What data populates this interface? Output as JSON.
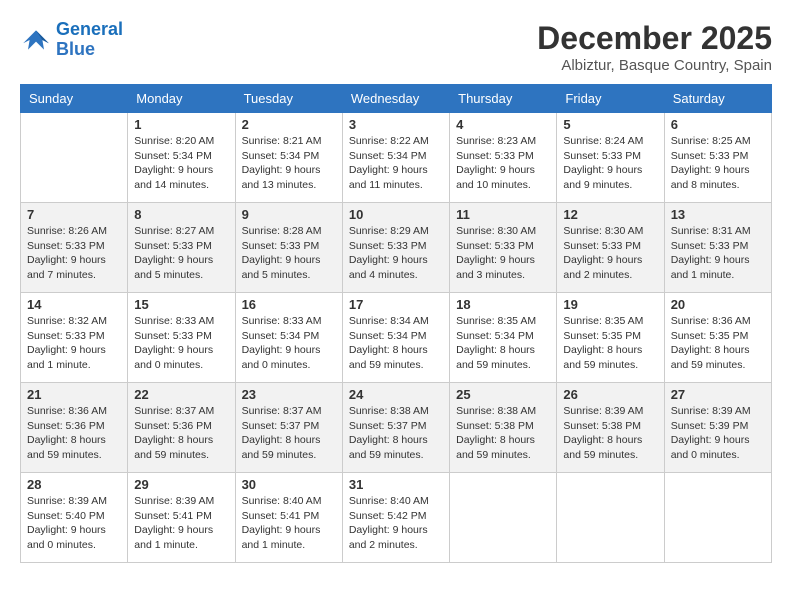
{
  "logo": {
    "line1": "General",
    "line2": "Blue"
  },
  "title": "December 2025",
  "location": "Albiztur, Basque Country, Spain",
  "days_of_week": [
    "Sunday",
    "Monday",
    "Tuesday",
    "Wednesday",
    "Thursday",
    "Friday",
    "Saturday"
  ],
  "weeks": [
    [
      {
        "day": "",
        "info": ""
      },
      {
        "day": "1",
        "info": "Sunrise: 8:20 AM\nSunset: 5:34 PM\nDaylight: 9 hours\nand 14 minutes."
      },
      {
        "day": "2",
        "info": "Sunrise: 8:21 AM\nSunset: 5:34 PM\nDaylight: 9 hours\nand 13 minutes."
      },
      {
        "day": "3",
        "info": "Sunrise: 8:22 AM\nSunset: 5:34 PM\nDaylight: 9 hours\nand 11 minutes."
      },
      {
        "day": "4",
        "info": "Sunrise: 8:23 AM\nSunset: 5:33 PM\nDaylight: 9 hours\nand 10 minutes."
      },
      {
        "day": "5",
        "info": "Sunrise: 8:24 AM\nSunset: 5:33 PM\nDaylight: 9 hours\nand 9 minutes."
      },
      {
        "day": "6",
        "info": "Sunrise: 8:25 AM\nSunset: 5:33 PM\nDaylight: 9 hours\nand 8 minutes."
      }
    ],
    [
      {
        "day": "7",
        "info": "Sunrise: 8:26 AM\nSunset: 5:33 PM\nDaylight: 9 hours\nand 7 minutes."
      },
      {
        "day": "8",
        "info": "Sunrise: 8:27 AM\nSunset: 5:33 PM\nDaylight: 9 hours\nand 5 minutes."
      },
      {
        "day": "9",
        "info": "Sunrise: 8:28 AM\nSunset: 5:33 PM\nDaylight: 9 hours\nand 5 minutes."
      },
      {
        "day": "10",
        "info": "Sunrise: 8:29 AM\nSunset: 5:33 PM\nDaylight: 9 hours\nand 4 minutes."
      },
      {
        "day": "11",
        "info": "Sunrise: 8:30 AM\nSunset: 5:33 PM\nDaylight: 9 hours\nand 3 minutes."
      },
      {
        "day": "12",
        "info": "Sunrise: 8:30 AM\nSunset: 5:33 PM\nDaylight: 9 hours\nand 2 minutes."
      },
      {
        "day": "13",
        "info": "Sunrise: 8:31 AM\nSunset: 5:33 PM\nDaylight: 9 hours\nand 1 minute."
      }
    ],
    [
      {
        "day": "14",
        "info": "Sunrise: 8:32 AM\nSunset: 5:33 PM\nDaylight: 9 hours\nand 1 minute."
      },
      {
        "day": "15",
        "info": "Sunrise: 8:33 AM\nSunset: 5:33 PM\nDaylight: 9 hours\nand 0 minutes."
      },
      {
        "day": "16",
        "info": "Sunrise: 8:33 AM\nSunset: 5:34 PM\nDaylight: 9 hours\nand 0 minutes."
      },
      {
        "day": "17",
        "info": "Sunrise: 8:34 AM\nSunset: 5:34 PM\nDaylight: 8 hours\nand 59 minutes."
      },
      {
        "day": "18",
        "info": "Sunrise: 8:35 AM\nSunset: 5:34 PM\nDaylight: 8 hours\nand 59 minutes."
      },
      {
        "day": "19",
        "info": "Sunrise: 8:35 AM\nSunset: 5:35 PM\nDaylight: 8 hours\nand 59 minutes."
      },
      {
        "day": "20",
        "info": "Sunrise: 8:36 AM\nSunset: 5:35 PM\nDaylight: 8 hours\nand 59 minutes."
      }
    ],
    [
      {
        "day": "21",
        "info": "Sunrise: 8:36 AM\nSunset: 5:36 PM\nDaylight: 8 hours\nand 59 minutes."
      },
      {
        "day": "22",
        "info": "Sunrise: 8:37 AM\nSunset: 5:36 PM\nDaylight: 8 hours\nand 59 minutes."
      },
      {
        "day": "23",
        "info": "Sunrise: 8:37 AM\nSunset: 5:37 PM\nDaylight: 8 hours\nand 59 minutes."
      },
      {
        "day": "24",
        "info": "Sunrise: 8:38 AM\nSunset: 5:37 PM\nDaylight: 8 hours\nand 59 minutes."
      },
      {
        "day": "25",
        "info": "Sunrise: 8:38 AM\nSunset: 5:38 PM\nDaylight: 8 hours\nand 59 minutes."
      },
      {
        "day": "26",
        "info": "Sunrise: 8:39 AM\nSunset: 5:38 PM\nDaylight: 8 hours\nand 59 minutes."
      },
      {
        "day": "27",
        "info": "Sunrise: 8:39 AM\nSunset: 5:39 PM\nDaylight: 9 hours\nand 0 minutes."
      }
    ],
    [
      {
        "day": "28",
        "info": "Sunrise: 8:39 AM\nSunset: 5:40 PM\nDaylight: 9 hours\nand 0 minutes."
      },
      {
        "day": "29",
        "info": "Sunrise: 8:39 AM\nSunset: 5:41 PM\nDaylight: 9 hours\nand 1 minute."
      },
      {
        "day": "30",
        "info": "Sunrise: 8:40 AM\nSunset: 5:41 PM\nDaylight: 9 hours\nand 1 minute."
      },
      {
        "day": "31",
        "info": "Sunrise: 8:40 AM\nSunset: 5:42 PM\nDaylight: 9 hours\nand 2 minutes."
      },
      {
        "day": "",
        "info": ""
      },
      {
        "day": "",
        "info": ""
      },
      {
        "day": "",
        "info": ""
      }
    ]
  ]
}
